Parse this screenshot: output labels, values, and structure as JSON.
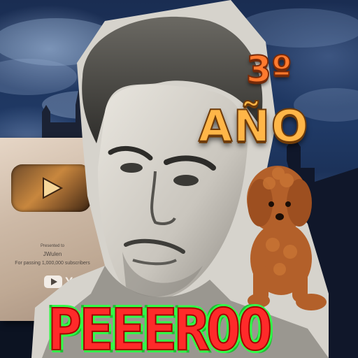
{
  "plaque": {
    "presented_to_label": "Presented to",
    "channel_name": "JWulen",
    "milestone_text": "For passing 1,000,000 subscribers",
    "brand": "YouTube"
  },
  "overlay": {
    "grade": "3º",
    "year": "AÑO",
    "name": "PEEEROO"
  },
  "icons": [
    "play-button-icon",
    "youtube-logo-icon"
  ],
  "colors": {
    "grade_text": "#ff7a2e",
    "year_text": "#ffb648",
    "name_fill": "#ff2a2a",
    "name_outline": "#31ff49",
    "sky": "#1a2d52"
  }
}
